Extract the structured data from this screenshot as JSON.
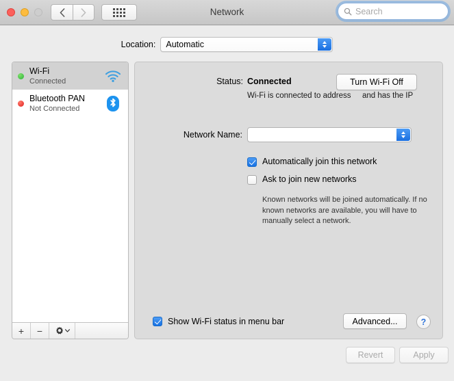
{
  "window": {
    "title": "Network",
    "traffic_lights": [
      "close",
      "minimize",
      "zoom"
    ]
  },
  "toolbar": {
    "back_label": "‹",
    "forward_label": "›",
    "show_all_label": "show-all-grid"
  },
  "search": {
    "placeholder": "Search",
    "value": ""
  },
  "location": {
    "label": "Location:",
    "value": "Automatic",
    "options": [
      "Automatic"
    ]
  },
  "sidebar": {
    "services": [
      {
        "name": "Wi-Fi",
        "state": "Connected",
        "status_color": "#2cb23a",
        "icon": "wifi-icon",
        "selected": true
      },
      {
        "name": "Bluetooth PAN",
        "state": "Not Connected",
        "status_color": "#e02020",
        "icon": "bluetooth-icon",
        "selected": false
      }
    ],
    "toolbar": {
      "add_label": "+",
      "remove_label": "−",
      "actions_label": "gear"
    }
  },
  "main": {
    "status_label": "Status:",
    "status_value": "Connected",
    "status_description": "Wi-Fi is connected to",
    "status_description_line2": "address",
    "status_description_right": "and has the IP",
    "turn_off_button": "Turn Wi-Fi Off",
    "network_name_label": "Network Name:",
    "network_name_value": "",
    "checkbox_auto_join": {
      "label": "Automatically join this network",
      "checked": true
    },
    "checkbox_ask_join": {
      "label": "Ask to join new networks",
      "checked": false
    },
    "hint": "Known networks will be joined automatically. If no known networks are available, you will have to manually select a network.",
    "checkbox_menu_bar": {
      "label": "Show Wi-Fi status in menu bar",
      "checked": true
    },
    "advanced_button": "Advanced...",
    "help_button": "?"
  },
  "footer": {
    "revert_button": "Revert",
    "apply_button": "Apply",
    "revert_enabled": false,
    "apply_enabled": false
  },
  "colors": {
    "accent": "#1671e3",
    "window_bg": "#ececec",
    "panel_bg": "#dcdcdc",
    "connected": "#2cb23a",
    "disconnected": "#e02020"
  }
}
